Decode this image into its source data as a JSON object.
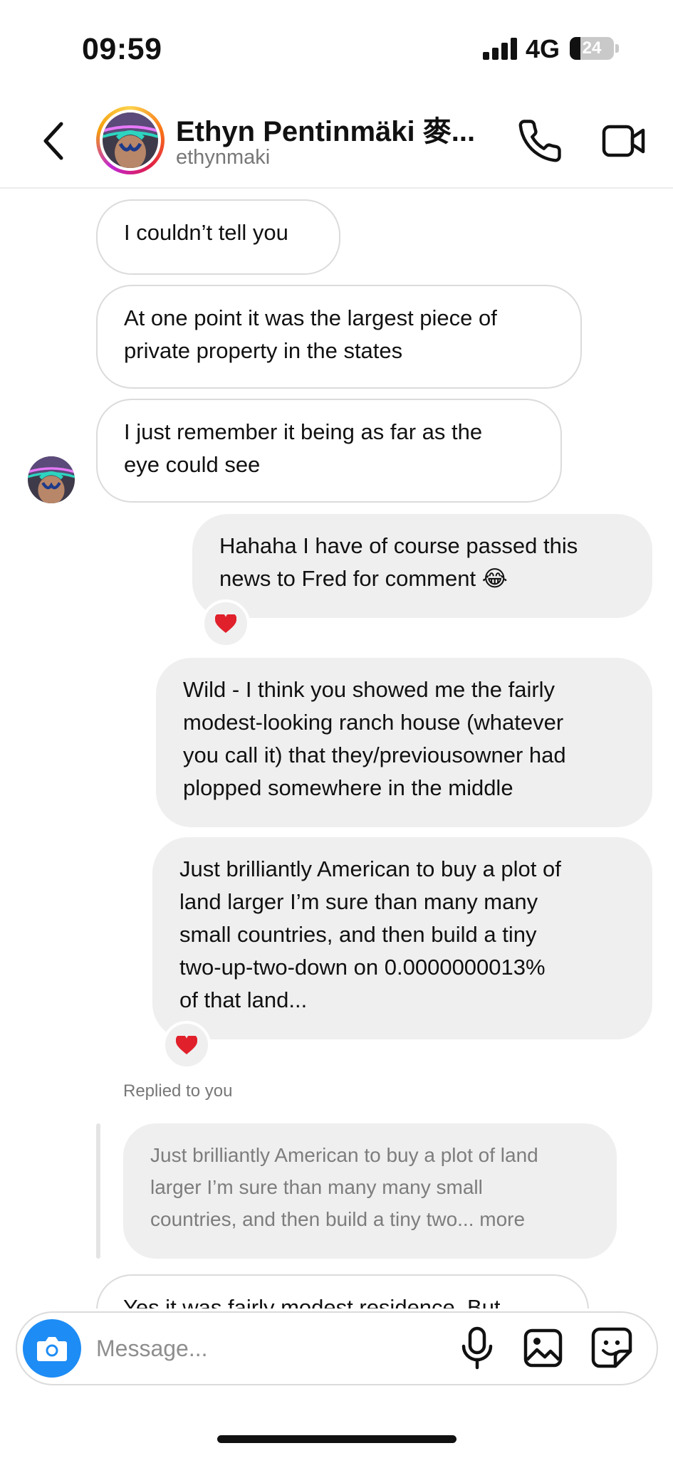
{
  "status_bar": {
    "time": "09:59",
    "network": "4G",
    "battery_level": "24",
    "battery_fraction": 0.24
  },
  "header": {
    "name": "Ethyn Pentinmäki 麥...",
    "username": "ethynmaki"
  },
  "messages": [
    {
      "from": "them",
      "text": "I couldn’t tell you"
    },
    {
      "from": "them",
      "text": "At one point it was the largest piece of\nprivate property in the states"
    },
    {
      "from": "them",
      "text": "I just remember it being as far as the\neye could see"
    },
    {
      "from": "me",
      "text": "Hahaha I have of course passed this\nnews to Fred for comment 😂",
      "reaction": "heart"
    },
    {
      "from": "me",
      "text": "Wild - I think you showed me the fairly\nmodest-looking ranch house (whatever\nyou call it) that they/previousowner had\nplopped somewhere in the middle"
    },
    {
      "from": "me",
      "text": "Just brilliantly American to buy a plot of\nland larger I’m sure than many many\nsmall countries, and then build a tiny\ntwo-up-two-down on 0.0000000013%\nof that land...",
      "reaction": "heart"
    }
  ],
  "reply": {
    "label": "Replied to you",
    "quote": "Just brilliantly American to buy a plot of land\nlarger I’m sure than many many small\ncountries, and then build a tiny two... more",
    "partial_message": "Yes it was fairly modest residence. But"
  },
  "composer": {
    "placeholder": "Message..."
  },
  "icons": {
    "back": "chevron-left-icon",
    "call": "phone-icon",
    "video": "video-camera-icon",
    "camera": "camera-icon",
    "mic": "microphone-icon",
    "gallery": "image-icon",
    "sticker": "sticker-icon",
    "reaction": "heart-icon"
  },
  "colors": {
    "camera_button": "#1d8cf5",
    "reaction_heart": "#e0202a",
    "outgoing_bubble": "#efefef",
    "incoming_border": "#dbdbdb"
  }
}
